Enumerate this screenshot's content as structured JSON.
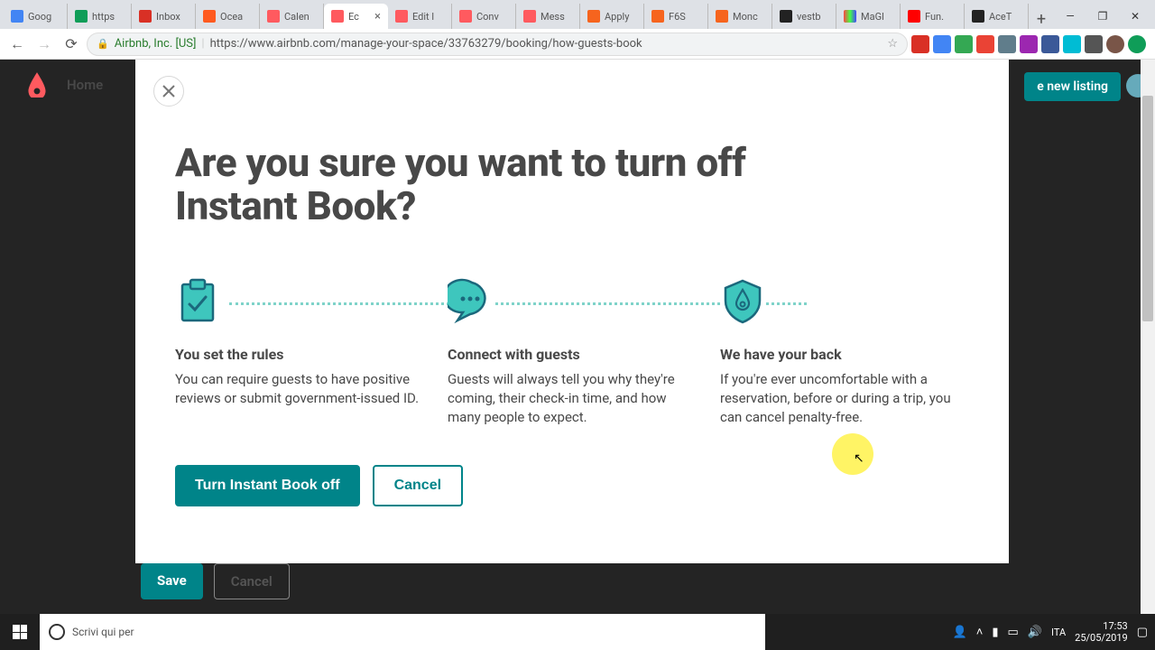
{
  "browser": {
    "tabs": [
      {
        "title": "Goog",
        "favicon_color": "#4285f4"
      },
      {
        "title": "https",
        "favicon_color": "#0f9d58"
      },
      {
        "title": "Inbox",
        "favicon_color": "#d93025"
      },
      {
        "title": "Ocea",
        "favicon_color": "#ff5a1f"
      },
      {
        "title": "Calen",
        "favicon_color": "#ff5a5f"
      },
      {
        "title": "Ec",
        "favicon_color": "#ff5a5f",
        "active": true
      },
      {
        "title": "Edit l",
        "favicon_color": "#ff5a5f"
      },
      {
        "title": "Conv",
        "favicon_color": "#ff5a5f"
      },
      {
        "title": "Mess",
        "favicon_color": "#ff5a5f"
      },
      {
        "title": "Apply",
        "favicon_color": "#f6641e"
      },
      {
        "title": "F6S",
        "favicon_color": "#f6641e"
      },
      {
        "title": "Monc",
        "favicon_color": "#f6641e"
      },
      {
        "title": "vestb",
        "favicon_color": "#222"
      },
      {
        "title": "MaGl",
        "favicon_color": "#8844ee"
      },
      {
        "title": "Fun.",
        "favicon_color": "#ff0000"
      },
      {
        "title": "AceT",
        "favicon_color": "#222"
      }
    ],
    "identity": "Airbnb, Inc. [US]",
    "url": "https://www.airbnb.com/manage-your-space/33763279/booking/how-guests-book"
  },
  "page_bg": {
    "home_label": "Home",
    "new_listing_label": "e new listing",
    "save_label": "Save",
    "cancel_label": "Cancel"
  },
  "modal": {
    "title": "Are you sure you want to turn off Instant Book?",
    "features": [
      {
        "icon": "clipboard-check",
        "title": "You set the rules",
        "desc": "You can require guests to have positive reviews or submit government-issued ID."
      },
      {
        "icon": "chat-bubble",
        "title": "Connect with guests",
        "desc": "Guests will always tell you why they're coming, their check-in time, and how many people to expect."
      },
      {
        "icon": "shield",
        "title": "We have your back",
        "desc": "If you're ever uncomfortable with a reservation, before or during a trip, you can cancel penalty-free."
      }
    ],
    "primary_label": "Turn Instant Book off",
    "secondary_label": "Cancel"
  },
  "taskbar": {
    "search_placeholder": "Scrivi qui per",
    "lang": "ITA",
    "time": "17:53",
    "date": "25/05/2019"
  },
  "colors": {
    "teal": "#008489",
    "text_dark": "#484848",
    "icon_fill": "#3ec6bd",
    "icon_stroke": "#1b687c"
  }
}
